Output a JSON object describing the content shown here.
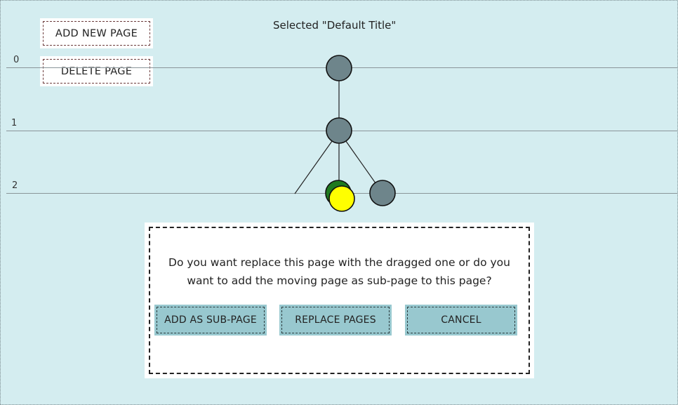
{
  "toolbar": {
    "add_page_label": "ADD NEW PAGE",
    "delete_page_label": "DELETE PAGE"
  },
  "header": {
    "selected_title": "Selected \"Default Title\""
  },
  "levels": [
    "0",
    "1",
    "2"
  ],
  "tree": {
    "node_color": "#6e858b",
    "dragged_color": "#ffff00",
    "target_color": "#1f7a1f"
  },
  "dialog": {
    "question": "Do you want replace this page with the dragged one or do you want to add the moving page as sub-page to this page?",
    "add_sub_label": "ADD AS SUB-PAGE",
    "replace_label": "REPLACE PAGES",
    "cancel_label": "CANCEL"
  },
  "colors": {
    "canvas_bg": "#d4edf0",
    "dialog_button_bg": "#98c8cf"
  }
}
